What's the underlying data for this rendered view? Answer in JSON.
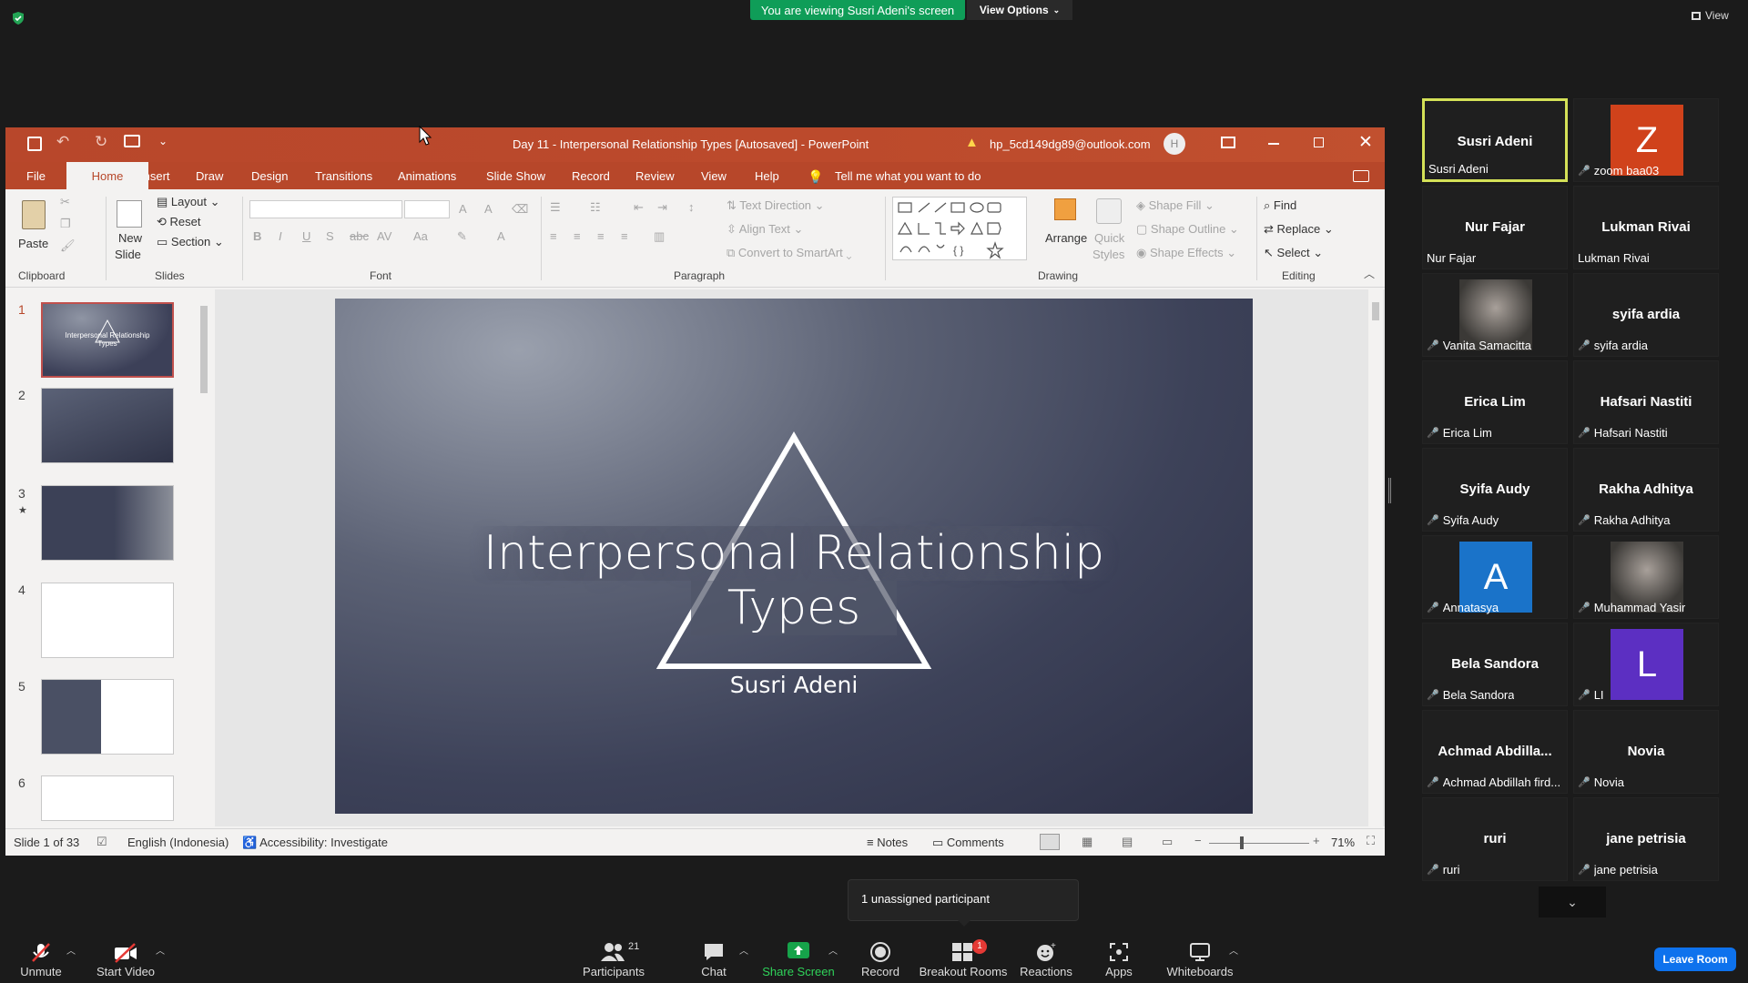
{
  "zoom": {
    "banner": "You are viewing Susri Adeni's screen",
    "view_options": "View Options",
    "view": "View",
    "tooltip": "1 unassigned participant",
    "leave_room": "Leave Room"
  },
  "ppt": {
    "title": "Day 11 - Interpersonal Relationship Types [Autosaved]  -  PowerPoint",
    "account": "hp_5cd149dg89@outlook.com",
    "avatar_letter": "H",
    "tabs": [
      "File",
      "Home",
      "Insert",
      "Draw",
      "Design",
      "Transitions",
      "Animations",
      "Slide Show",
      "Record",
      "Review",
      "View",
      "Help"
    ],
    "tell_me": "Tell me what you want to do",
    "ribbon": {
      "paste": "Paste",
      "new_slide": "New",
      "new_slide2": "Slide",
      "layout": "Layout",
      "reset": "Reset",
      "section": "Section",
      "text_direction": "Text Direction",
      "align_text": "Align Text",
      "convert_smartart": "Convert to SmartArt",
      "arrange": "Arrange",
      "quick_styles": "Quick",
      "quick_styles2": "Styles",
      "shape_fill": "Shape Fill",
      "shape_outline": "Shape Outline",
      "shape_effects": "Shape Effects",
      "find": "Find",
      "replace": "Replace",
      "select": "Select",
      "groups": [
        "Clipboard",
        "Slides",
        "Font",
        "Paragraph",
        "Drawing",
        "Editing"
      ]
    },
    "thumbnails": [
      "1",
      "2",
      "3",
      "4",
      "5",
      "6"
    ],
    "slide": {
      "title_line1": "Interpersonal Relationship",
      "title_line2": "Types",
      "subtitle": "Susri Adeni",
      "thumb_title": "Interpersonal Relationship Types"
    },
    "status": {
      "slide_of": "Slide 1 of 33",
      "language": "English (Indonesia)",
      "accessibility": "Accessibility: Investigate",
      "notes": "Notes",
      "comments": "Comments",
      "zoom": "71%"
    }
  },
  "participants": [
    {
      "name": "Susri Adeni",
      "label": "Susri Adeni",
      "type": "text",
      "active": true,
      "muted": false
    },
    {
      "name": "Z",
      "label": "zoom baa03",
      "type": "avatar",
      "color": "#d0421b",
      "muted": true
    },
    {
      "name": "Nur Fajar",
      "label": "Nur Fajar",
      "type": "text",
      "muted": false
    },
    {
      "name": "Lukman Rivai",
      "label": "Lukman Rivai",
      "type": "text",
      "muted": false
    },
    {
      "name": "",
      "label": "Vanita Samacitta",
      "type": "photo",
      "muted": true
    },
    {
      "name": "syifa ardia",
      "label": "syifa ardia",
      "type": "text",
      "muted": true
    },
    {
      "name": "Erica Lim",
      "label": "Erica Lim",
      "type": "text",
      "muted": true
    },
    {
      "name": "Hafsari Nastiti",
      "label": "Hafsari Nastiti",
      "type": "text",
      "muted": true
    },
    {
      "name": "Syifa Audy",
      "label": "Syifa Audy",
      "type": "text",
      "muted": true
    },
    {
      "name": "Rakha Adhitya",
      "label": "Rakha Adhitya",
      "type": "text",
      "muted": true
    },
    {
      "name": "A",
      "label": "Annatasya",
      "type": "avatar",
      "color": "#1a73c9",
      "muted": true
    },
    {
      "name": "",
      "label": "Muhammad Yasir",
      "type": "photo",
      "muted": true
    },
    {
      "name": "Bela Sandora",
      "label": "Bela Sandora",
      "type": "text",
      "muted": true
    },
    {
      "name": "L",
      "label": "LI",
      "type": "avatar",
      "color": "#5c2fc2",
      "muted": true
    },
    {
      "name": "Achmad  Abdilla...",
      "label": "Achmad Abdillah fird...",
      "type": "text",
      "muted": true
    },
    {
      "name": "Novia",
      "label": "Novia",
      "type": "text",
      "muted": true
    },
    {
      "name": "ruri",
      "label": "ruri",
      "type": "text",
      "muted": true
    },
    {
      "name": "jane petrisia",
      "label": "jane petrisia",
      "type": "text",
      "muted": true
    }
  ],
  "toolbar": {
    "unmute": "Unmute",
    "start_video": "Start Video",
    "participants": "Participants",
    "participants_count": "21",
    "chat": "Chat",
    "share_screen": "Share Screen",
    "record": "Record",
    "breakout_rooms": "Breakout Rooms",
    "breakout_badge": "1",
    "reactions": "Reactions",
    "apps": "Apps",
    "whiteboards": "Whiteboards"
  },
  "colors": {
    "ppt_accent": "#b7472a",
    "share_green": "#0f9d58",
    "leave_blue": "#0e72ed"
  }
}
